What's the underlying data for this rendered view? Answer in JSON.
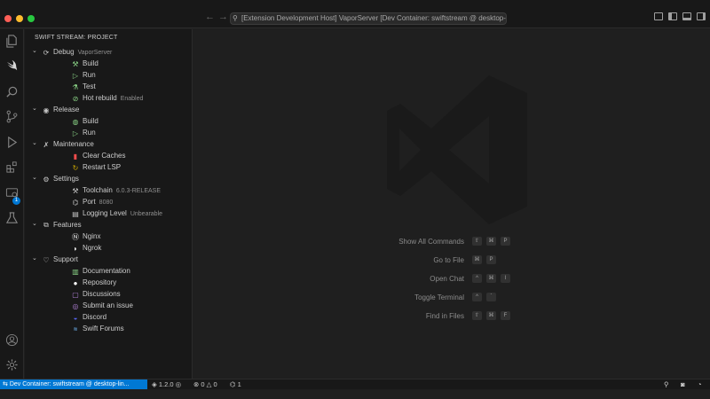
{
  "titlebar": {
    "window_title": "[Extension Development Host] VaporServer [Dev Container: swiftstream @ desktop-linux"
  },
  "sidebar": {
    "title": "SWIFT STREAM: PROJECT",
    "groups": [
      {
        "label": "Debug",
        "description": "VaporServer",
        "icon": "debug-icon",
        "children": [
          {
            "label": "Build",
            "description": "",
            "icon": "hammer-icon"
          },
          {
            "label": "Run",
            "description": "",
            "icon": "play-icon"
          },
          {
            "label": "Test",
            "description": "",
            "icon": "beaker-icon"
          },
          {
            "label": "Hot rebuild",
            "description": "Enabled",
            "icon": "check-circle-icon"
          }
        ]
      },
      {
        "label": "Release",
        "description": "",
        "icon": "eye-icon",
        "children": [
          {
            "label": "Build",
            "description": "",
            "icon": "globe-icon"
          },
          {
            "label": "Run",
            "description": "",
            "icon": "play-icon"
          }
        ]
      },
      {
        "label": "Maintenance",
        "description": "",
        "icon": "tools-icon",
        "children": [
          {
            "label": "Clear Caches",
            "description": "",
            "icon": "trash-icon"
          },
          {
            "label": "Restart LSP",
            "description": "",
            "icon": "restart-icon"
          }
        ]
      },
      {
        "label": "Settings",
        "description": "",
        "icon": "gear-icon",
        "children": [
          {
            "label": "Toolchain",
            "description": "6.0.3-RELEASE",
            "icon": "toolchain-icon"
          },
          {
            "label": "Port",
            "description": "8080",
            "icon": "port-icon"
          },
          {
            "label": "Logging Level",
            "description": "Unbearable",
            "icon": "log-icon"
          }
        ]
      },
      {
        "label": "Features",
        "description": "",
        "icon": "extensions-icon",
        "children": [
          {
            "label": "Nginx",
            "description": "",
            "icon": "nginx-icon"
          },
          {
            "label": "Ngrok",
            "description": "",
            "icon": "ngrok-icon"
          }
        ]
      },
      {
        "label": "Support",
        "description": "",
        "icon": "heart-icon",
        "children": [
          {
            "label": "Documentation",
            "description": "",
            "icon": "book-icon"
          },
          {
            "label": "Repository",
            "description": "",
            "icon": "github-icon"
          },
          {
            "label": "Discussions",
            "description": "",
            "icon": "comments-icon"
          },
          {
            "label": "Submit an issue",
            "description": "",
            "icon": "issue-icon"
          },
          {
            "label": "Discord",
            "description": "",
            "icon": "discord-icon"
          },
          {
            "label": "Swift Forums",
            "description": "",
            "icon": "forum-icon"
          }
        ]
      }
    ]
  },
  "editor": {
    "shortcuts": [
      {
        "label": "Show All Commands",
        "keys": [
          "⇧",
          "⌘",
          "P"
        ]
      },
      {
        "label": "Go to File",
        "keys": [
          "⌘",
          "P"
        ]
      },
      {
        "label": "Open Chat",
        "keys": [
          "^",
          "⌘",
          "I"
        ]
      },
      {
        "label": "Toggle Terminal",
        "keys": [
          "^",
          "`"
        ]
      },
      {
        "label": "Find in Files",
        "keys": [
          "⇧",
          "⌘",
          "F"
        ]
      }
    ]
  },
  "activitybar": {
    "extensions_badge": "1"
  },
  "statusbar": {
    "remote": "Dev Container: swiftstream @ desktop-lin...",
    "version": "1.2.0",
    "errors": "0",
    "warnings": "0",
    "ports": "1"
  },
  "colors": {
    "accent": "#0078d4",
    "background": "#1f1f1f",
    "sidebar_bg": "#181818"
  }
}
